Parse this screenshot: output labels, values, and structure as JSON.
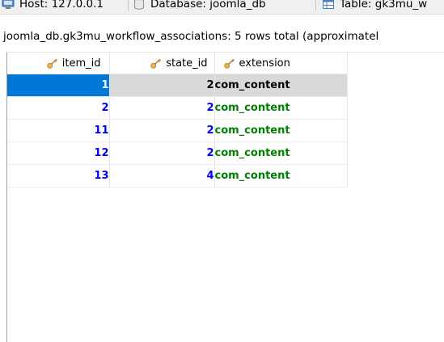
{
  "tabs": {
    "host_label": "Host: 127.0.0.1",
    "database_label": "Database: joomla_db",
    "table_label": "Table: gk3mu_w"
  },
  "info": {
    "text": "joomla_db.gk3mu_workflow_associations: 5 rows total (approximatel"
  },
  "grid": {
    "columns": [
      "item_id",
      "state_id",
      "extension"
    ],
    "rows": [
      {
        "item_id": "1",
        "state_id": "2",
        "extension": "com_content"
      },
      {
        "item_id": "2",
        "state_id": "2",
        "extension": "com_content"
      },
      {
        "item_id": "11",
        "state_id": "2",
        "extension": "com_content"
      },
      {
        "item_id": "12",
        "state_id": "2",
        "extension": "com_content"
      },
      {
        "item_id": "13",
        "state_id": "4",
        "extension": "com_content"
      }
    ]
  },
  "colors": {
    "selection": "#0078d7",
    "number": "#0000ff",
    "text_value": "#008000",
    "key_icon": "#e6b84a"
  },
  "icons": [
    "host-icon",
    "database-icon",
    "table-icon",
    "key-icon"
  ]
}
